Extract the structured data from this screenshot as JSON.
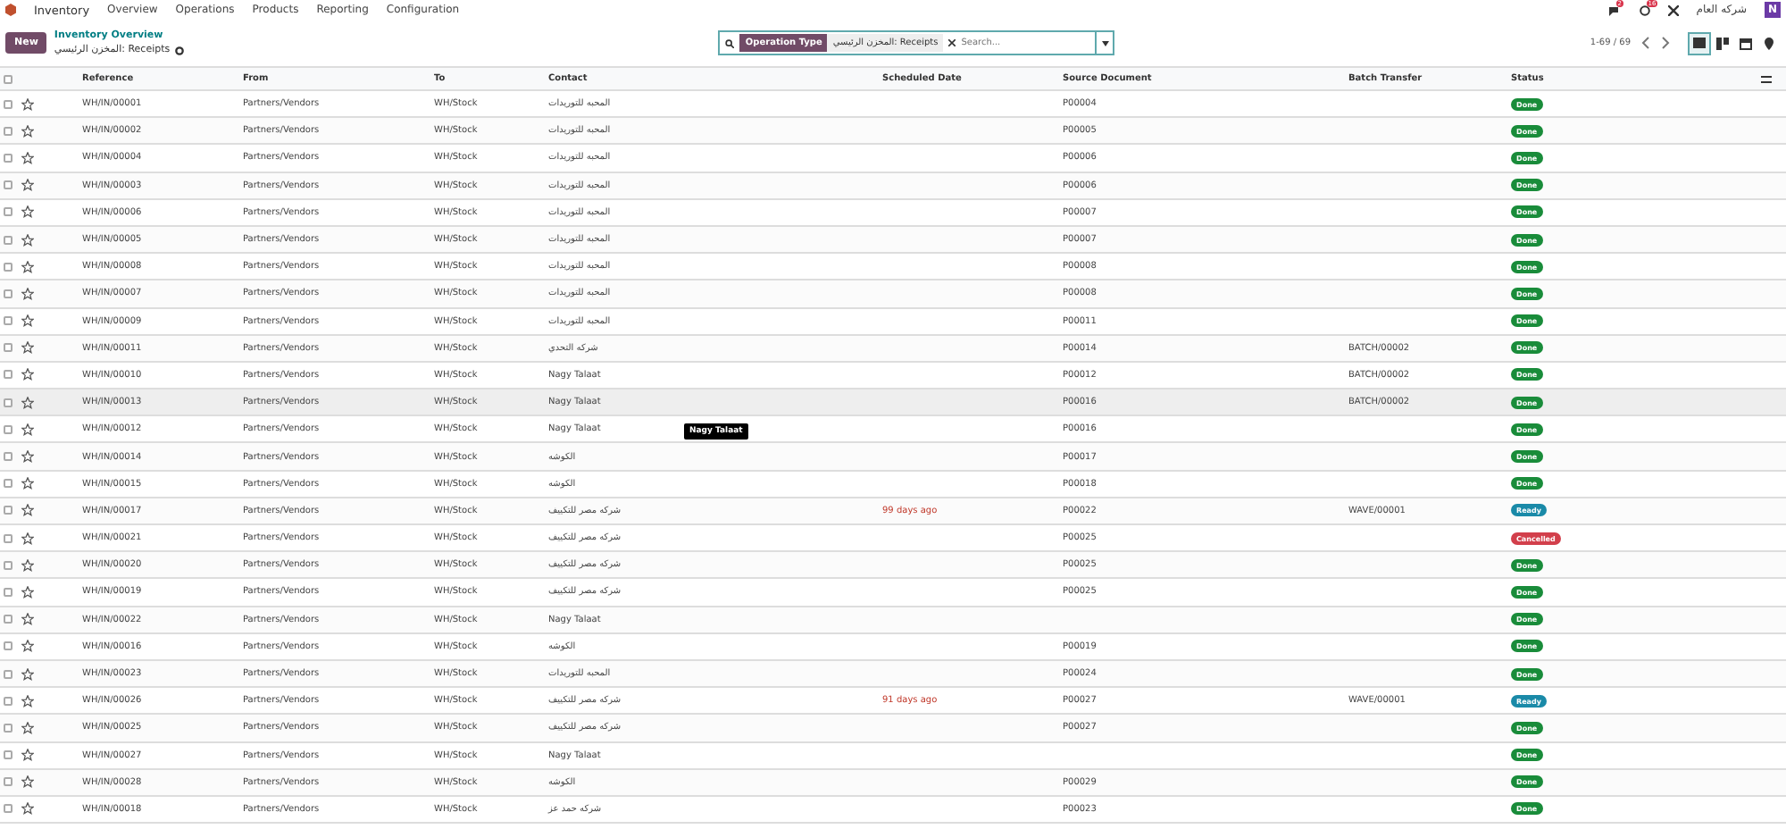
{
  "topbar": {
    "app": "Inventory",
    "menu": [
      "Overview",
      "Operations",
      "Products",
      "Reporting",
      "Configuration"
    ],
    "messages_badge": "2",
    "activity_badge": "16",
    "company": "شركه العام",
    "avatar": "N"
  },
  "control_panel": {
    "new_button": "New",
    "breadcrumb": "Inventory Overview",
    "title": "المخزن الرئيسي: Receipts",
    "search": {
      "facet_label": "Operation Type",
      "facet_value": "المخزن الرئيسي: Receipts",
      "placeholder": "Search..."
    },
    "pager": "1-69 / 69",
    "views": [
      {
        "kind": "list",
        "selected": true
      },
      {
        "kind": "kanban",
        "selected": false
      },
      {
        "kind": "calendar",
        "selected": false
      },
      {
        "kind": "map",
        "selected": false
      }
    ]
  },
  "table": {
    "all_checked": false,
    "columns": [
      "Reference",
      "From",
      "To",
      "Contact",
      "Scheduled Date",
      "Source Document",
      "Batch Transfer",
      "Status"
    ],
    "rows": [
      {
        "checked": false,
        "reference": "WH/IN/00001",
        "from": "Partners/Vendors",
        "to": "WH/Stock",
        "contact": "المحبه للتوريدات",
        "scheduled": "",
        "source": "P00004",
        "batch": "",
        "status": "Done",
        "kind": "done",
        "highlighted": false
      },
      {
        "checked": false,
        "reference": "WH/IN/00002",
        "from": "Partners/Vendors",
        "to": "WH/Stock",
        "contact": "المحبه للتوريدات",
        "scheduled": "",
        "source": "P00005",
        "batch": "",
        "status": "Done",
        "kind": "done",
        "highlighted": false
      },
      {
        "checked": false,
        "reference": "WH/IN/00004",
        "from": "Partners/Vendors",
        "to": "WH/Stock",
        "contact": "المحبه للتوريدات",
        "scheduled": "",
        "source": "P00006",
        "batch": "",
        "status": "Done",
        "kind": "done",
        "highlighted": false
      },
      {
        "checked": false,
        "reference": "WH/IN/00003",
        "from": "Partners/Vendors",
        "to": "WH/Stock",
        "contact": "المحبه للتوريدات",
        "scheduled": "",
        "source": "P00006",
        "batch": "",
        "status": "Done",
        "kind": "done",
        "highlighted": false
      },
      {
        "checked": false,
        "reference": "WH/IN/00006",
        "from": "Partners/Vendors",
        "to": "WH/Stock",
        "contact": "المحبه للتوريدات",
        "scheduled": "",
        "source": "P00007",
        "batch": "",
        "status": "Done",
        "kind": "done",
        "highlighted": false
      },
      {
        "checked": false,
        "reference": "WH/IN/00005",
        "from": "Partners/Vendors",
        "to": "WH/Stock",
        "contact": "المحبه للتوريدات",
        "scheduled": "",
        "source": "P00007",
        "batch": "",
        "status": "Done",
        "kind": "done",
        "highlighted": false
      },
      {
        "checked": false,
        "reference": "WH/IN/00008",
        "from": "Partners/Vendors",
        "to": "WH/Stock",
        "contact": "المحبه للتوريدات",
        "scheduled": "",
        "source": "P00008",
        "batch": "",
        "status": "Done",
        "kind": "done",
        "highlighted": false
      },
      {
        "checked": false,
        "reference": "WH/IN/00007",
        "from": "Partners/Vendors",
        "to": "WH/Stock",
        "contact": "المحبه للتوريدات",
        "scheduled": "",
        "source": "P00008",
        "batch": "",
        "status": "Done",
        "kind": "done",
        "highlighted": false
      },
      {
        "checked": false,
        "reference": "WH/IN/00009",
        "from": "Partners/Vendors",
        "to": "WH/Stock",
        "contact": "المحبه للتوريدات",
        "scheduled": "",
        "source": "P00011",
        "batch": "",
        "status": "Done",
        "kind": "done",
        "highlighted": false
      },
      {
        "checked": false,
        "reference": "WH/IN/00011",
        "from": "Partners/Vendors",
        "to": "WH/Stock",
        "contact": "شركه التحدي",
        "scheduled": "",
        "source": "P00014",
        "batch": "BATCH/00002",
        "status": "Done",
        "kind": "done",
        "highlighted": false
      },
      {
        "checked": false,
        "reference": "WH/IN/00010",
        "from": "Partners/Vendors",
        "to": "WH/Stock",
        "contact": "Nagy Talaat",
        "scheduled": "",
        "source": "P00012",
        "batch": "BATCH/00002",
        "status": "Done",
        "kind": "done",
        "highlighted": false
      },
      {
        "checked": false,
        "reference": "WH/IN/00013",
        "from": "Partners/Vendors",
        "to": "WH/Stock",
        "contact": "Nagy Talaat",
        "scheduled": "",
        "source": "P00016",
        "batch": "BATCH/00002",
        "status": "Done",
        "kind": "done",
        "highlighted": true
      },
      {
        "checked": false,
        "reference": "WH/IN/00012",
        "from": "Partners/Vendors",
        "to": "WH/Stock",
        "contact": "Nagy Talaat",
        "scheduled": "",
        "source": "P00016",
        "batch": "",
        "status": "Done",
        "kind": "done",
        "highlighted": false
      },
      {
        "checked": false,
        "reference": "WH/IN/00014",
        "from": "Partners/Vendors",
        "to": "WH/Stock",
        "contact": "الكوشه",
        "scheduled": "",
        "source": "P00017",
        "batch": "",
        "status": "Done",
        "kind": "done",
        "highlighted": false
      },
      {
        "checked": false,
        "reference": "WH/IN/00015",
        "from": "Partners/Vendors",
        "to": "WH/Stock",
        "contact": "الكوشه",
        "scheduled": "",
        "source": "P00018",
        "batch": "",
        "status": "Done",
        "kind": "done",
        "highlighted": false
      },
      {
        "checked": false,
        "reference": "WH/IN/00017",
        "from": "Partners/Vendors",
        "to": "WH/Stock",
        "contact": "شركه مصر للتكييف",
        "scheduled": "99 days ago",
        "source": "P00022",
        "batch": "WAVE/00001",
        "status": "Ready",
        "kind": "ready",
        "highlighted": false
      },
      {
        "checked": false,
        "reference": "WH/IN/00021",
        "from": "Partners/Vendors",
        "to": "WH/Stock",
        "contact": "شركه مصر للتكييف",
        "scheduled": "",
        "source": "P00025",
        "batch": "",
        "status": "Cancelled",
        "kind": "cancelled",
        "highlighted": false
      },
      {
        "checked": false,
        "reference": "WH/IN/00020",
        "from": "Partners/Vendors",
        "to": "WH/Stock",
        "contact": "شركه مصر للتكييف",
        "scheduled": "",
        "source": "P00025",
        "batch": "",
        "status": "Done",
        "kind": "done",
        "highlighted": false
      },
      {
        "checked": false,
        "reference": "WH/IN/00019",
        "from": "Partners/Vendors",
        "to": "WH/Stock",
        "contact": "شركه مصر للتكييف",
        "scheduled": "",
        "source": "P00025",
        "batch": "",
        "status": "Done",
        "kind": "done",
        "highlighted": false
      },
      {
        "checked": false,
        "reference": "WH/IN/00022",
        "from": "Partners/Vendors",
        "to": "WH/Stock",
        "contact": "Nagy Talaat",
        "scheduled": "",
        "source": "",
        "batch": "",
        "status": "Done",
        "kind": "done",
        "highlighted": false
      },
      {
        "checked": false,
        "reference": "WH/IN/00016",
        "from": "Partners/Vendors",
        "to": "WH/Stock",
        "contact": "الكوشه",
        "scheduled": "",
        "source": "P00019",
        "batch": "",
        "status": "Done",
        "kind": "done",
        "highlighted": false
      },
      {
        "checked": false,
        "reference": "WH/IN/00023",
        "from": "Partners/Vendors",
        "to": "WH/Stock",
        "contact": "المحبه للتوريدات",
        "scheduled": "",
        "source": "P00024",
        "batch": "",
        "status": "Done",
        "kind": "done",
        "highlighted": false
      },
      {
        "checked": false,
        "reference": "WH/IN/00026",
        "from": "Partners/Vendors",
        "to": "WH/Stock",
        "contact": "شركه مصر للتكييف",
        "scheduled": "91 days ago",
        "source": "P00027",
        "batch": "WAVE/00001",
        "status": "Ready",
        "kind": "ready",
        "highlighted": false
      },
      {
        "checked": false,
        "reference": "WH/IN/00025",
        "from": "Partners/Vendors",
        "to": "WH/Stock",
        "contact": "شركه مصر للتكييف",
        "scheduled": "",
        "source": "P00027",
        "batch": "",
        "status": "Done",
        "kind": "done",
        "highlighted": false
      },
      {
        "checked": false,
        "reference": "WH/IN/00027",
        "from": "Partners/Vendors",
        "to": "WH/Stock",
        "contact": "Nagy Talaat",
        "scheduled": "",
        "source": "",
        "batch": "",
        "status": "Done",
        "kind": "done",
        "highlighted": false
      },
      {
        "checked": false,
        "reference": "WH/IN/00028",
        "from": "Partners/Vendors",
        "to": "WH/Stock",
        "contact": "الكوشه",
        "scheduled": "",
        "source": "P00029",
        "batch": "",
        "status": "Done",
        "kind": "done",
        "highlighted": false
      },
      {
        "checked": false,
        "reference": "WH/IN/00018",
        "from": "Partners/Vendors",
        "to": "WH/Stock",
        "contact": "شركه حمد عز",
        "scheduled": "",
        "source": "P00023",
        "batch": "",
        "status": "Done",
        "kind": "done",
        "highlighted": false
      }
    ]
  },
  "tooltip": "Nagy Talaat"
}
